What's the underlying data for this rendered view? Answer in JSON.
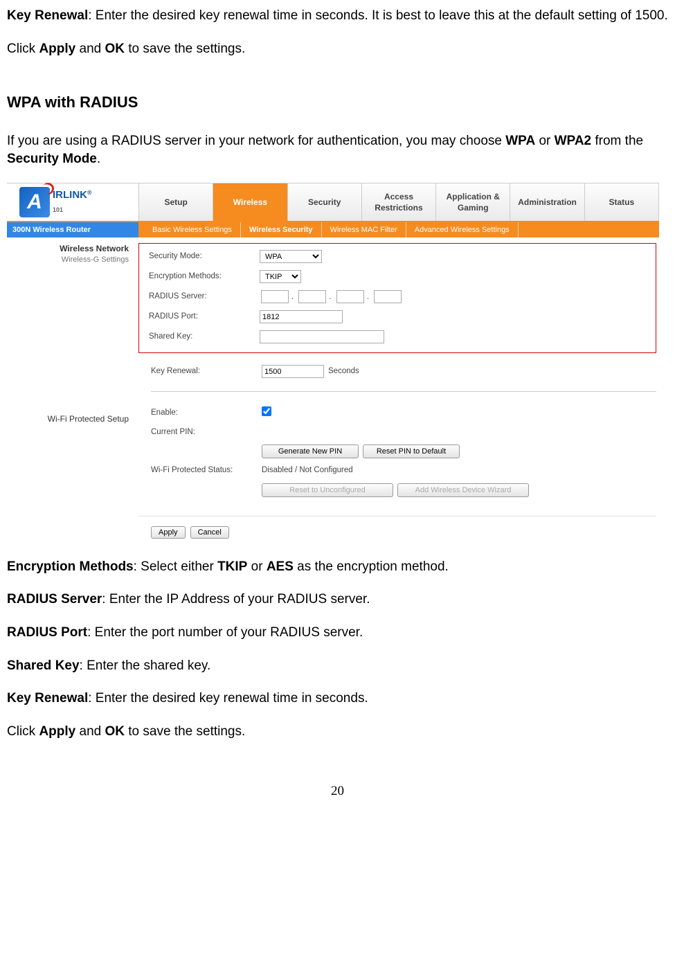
{
  "doc": {
    "p1a": "Key Renewal",
    "p1b": ": Enter the desired key renewal time in seconds.  It is best to leave this at the default setting of 1500.",
    "p2a": "Click ",
    "p2b": "Apply",
    "p2c": " and ",
    "p2d": "OK",
    "p2e": " to save the settings.",
    "h1": "WPA with RADIUS",
    "p3a": "If you are using a RADIUS server in your network for authentication, you may choose ",
    "p3b": "WPA",
    "p3c": " or ",
    "p3d": "WPA2",
    "p3e": " from the ",
    "p3f": "Security Mode",
    "p3g": ".",
    "p4a": "Encryption Methods",
    "p4b": ": Select either ",
    "p4c": "TKIP",
    "p4d": " or ",
    "p4e": "AES",
    "p4f": " as the encryption method.",
    "p5a": "RADIUS Server",
    "p5b": ": Enter the IP Address of your RADIUS server.",
    "p6a": "RADIUS Port",
    "p6b": ": Enter the port number of your RADIUS server.",
    "p7a": "Shared Key",
    "p7b": ": Enter the shared key.",
    "p8a": "Key Renewal",
    "p8b": ": Enter the desired key renewal time in seconds.",
    "p9a": "Click ",
    "p9b": "Apply",
    "p9c": " and ",
    "p9d": "OK",
    "p9e": " to save the settings.",
    "page": "20"
  },
  "ui": {
    "logo": {
      "letter": "A",
      "text": "IRLINK",
      "sub": "101",
      "reg": "®"
    },
    "tabs": [
      "Setup",
      "Wireless",
      "Security",
      "Access Restrictions",
      "Application & Gaming",
      "Administration",
      "Status"
    ],
    "model": "300N Wireless Router",
    "subtabs": [
      "Basic Wireless Settings",
      "Wireless Security",
      "Wireless MAC Filter",
      "Advanced Wireless Settings"
    ],
    "left": {
      "sect1": "Wireless Network",
      "sub1": "Wireless-G Settings",
      "sect2": "Wi-Fi Protected Setup"
    },
    "fields": {
      "secmode_l": "Security Mode:",
      "secmode_v": "WPA",
      "enc_l": "Encryption Methods:",
      "enc_v": "TKIP",
      "radsrv_l": "RADIUS Server:",
      "radport_l": "RADIUS Port:",
      "radport_v": "1812",
      "shkey_l": "Shared Key:",
      "kr_l": "Key Renewal:",
      "kr_v": "1500",
      "kr_suffix": "Seconds",
      "enable_l": "Enable:",
      "curpin_l": "Current PIN:",
      "genpin": "Generate New PIN",
      "resetpin": "Reset PIN to Default",
      "wpsstat_l": "Wi-Fi Protected Status:",
      "wpsstat_v": "Disabled / Not Configured",
      "resetun": "Reset to Unconfigured",
      "addwiz": "Add Wireless Device Wizard",
      "apply": "Apply",
      "cancel": "Cancel"
    }
  }
}
